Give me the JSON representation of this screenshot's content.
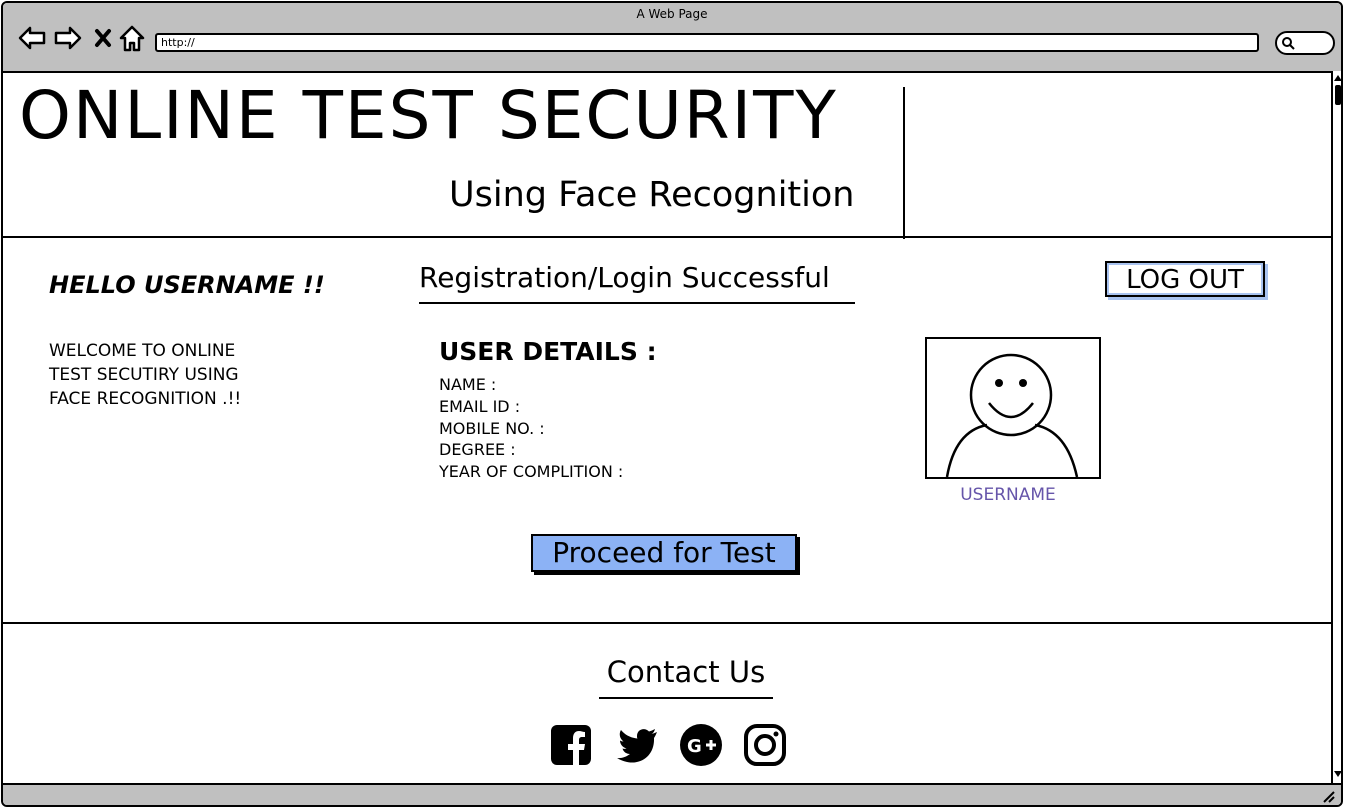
{
  "window": {
    "title": "A Web Page"
  },
  "browser": {
    "url": "http://"
  },
  "header": {
    "title": "ONLINE TEST SECURITY",
    "subtitle": "Using Face Recognition"
  },
  "greeting": "HELLO USERNAME !!",
  "welcome_lines": [
    "WELCOME TO ONLINE",
    "TEST SECUTIRY USING",
    "FACE RECOGNITION .!!"
  ],
  "status_title": "Registration/Login Successful",
  "logout_label": "LOG OUT",
  "user_details": {
    "title": "USER DETAILS :",
    "fields": [
      "NAME :",
      "EMAIL ID :",
      "MOBILE NO. :",
      "DEGREE :",
      "YEAR OF COMPLITION :"
    ]
  },
  "avatar": {
    "label": "USERNAME",
    "icon": "user-avatar-icon"
  },
  "proceed_label": "Proceed for Test",
  "footer": {
    "contact_title": "Contact Us",
    "social": [
      "facebook-icon",
      "twitter-icon",
      "google-plus-icon",
      "instagram-icon"
    ]
  },
  "colors": {
    "accent": "#8cb2f5",
    "chrome": "#c0c0c0",
    "username": "#6655aa"
  }
}
